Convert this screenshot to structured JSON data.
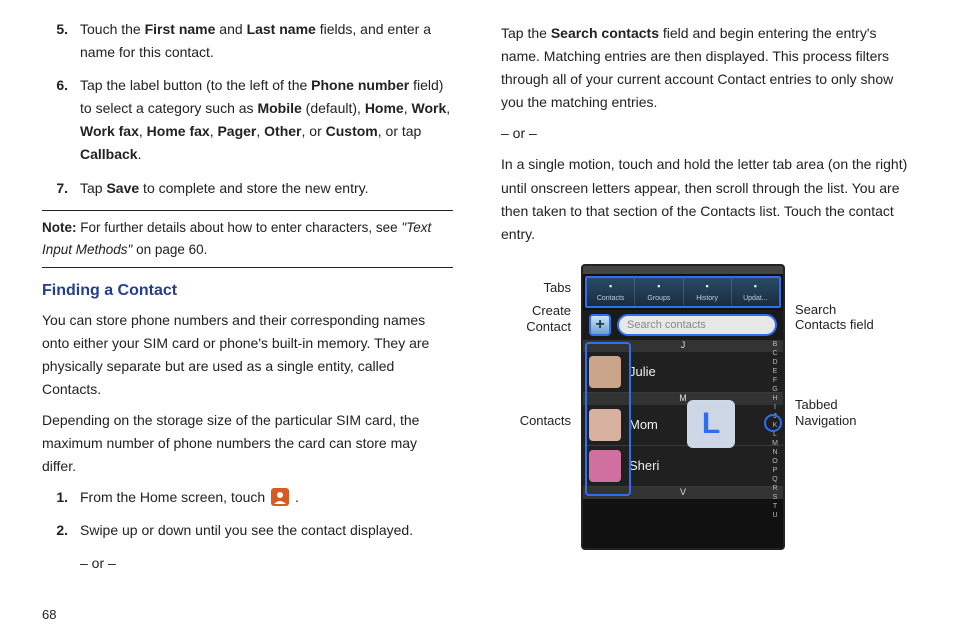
{
  "left": {
    "steps": [
      {
        "n": "5.",
        "parts": [
          "Touch the ",
          {
            "b": "First name"
          },
          " and ",
          {
            "b": "Last name"
          },
          " fields, and enter a name for this contact."
        ]
      },
      {
        "n": "6.",
        "parts": [
          "Tap the label button (to the left of the ",
          {
            "b": "Phone number"
          },
          " field) to select a category such as ",
          {
            "b": "Mobile"
          },
          " (default), ",
          {
            "b": "Home"
          },
          ", ",
          {
            "b": "Work"
          },
          ", ",
          {
            "b": "Work fax"
          },
          ", ",
          {
            "b": "Home fax"
          },
          ", ",
          {
            "b": "Pager"
          },
          ", ",
          {
            "b": "Other"
          },
          ", or ",
          {
            "b": "Custom"
          },
          ", or tap ",
          {
            "b": "Callback"
          },
          "."
        ]
      },
      {
        "n": "7.",
        "parts": [
          "Tap ",
          {
            "b": "Save"
          },
          " to complete and store the new entry."
        ]
      }
    ],
    "note_prefix": "Note:",
    "note_parts": [
      " For further details about how to enter characters, see ",
      {
        "i": "\"Text Input Methods\""
      },
      " on page 60."
    ],
    "heading": "Finding a Contact",
    "para1": "You can store phone numbers and their corresponding names onto either your SIM card or phone's built-in memory. They are physically separate but are used as a single entity, called Contacts.",
    "para2": "Depending on the storage size of the particular SIM card, the maximum number of phone numbers the card can store may differ.",
    "substeps": [
      {
        "n": "1.",
        "parts": [
          "From the Home screen, touch ",
          {
            "icon": true
          },
          " ."
        ]
      },
      {
        "n": "2.",
        "parts": [
          "Swipe up or down until you see the contact displayed."
        ]
      }
    ],
    "or": "– or –"
  },
  "right": {
    "para1_parts": [
      "Tap the ",
      {
        "b": "Search contacts"
      },
      " field and begin entering the entry's name. Matching entries are then displayed. This process filters through all of your current account Contact entries to only show you the matching entries."
    ],
    "or": "– or –",
    "para2": "In a single motion, touch and hold the letter tab area (on the right) until onscreen letters appear, then scroll through the list. You are then taken to that section of the Contacts list. Touch the contact entry."
  },
  "figure": {
    "left_labels": {
      "tabs": "Tabs",
      "create": "Create Contact",
      "contacts": "Contacts"
    },
    "right_labels": {
      "search": "Search Contacts field",
      "tabnav": "Tabbed Navigation"
    },
    "phone": {
      "tabs": [
        "Contacts",
        "Groups",
        "History",
        "Updat..."
      ],
      "search_placeholder": "Search contacts",
      "add_symbol": "+",
      "letter_popup": "L",
      "letter_strip": [
        "B",
        "C",
        "D",
        "E",
        "F",
        "G",
        "H",
        "I",
        "J",
        "K",
        "L",
        "M",
        "N",
        "O",
        "P",
        "Q",
        "R",
        "S",
        "T",
        "U"
      ],
      "dividers": [
        "J",
        "M",
        "V"
      ],
      "entries": [
        {
          "name": "Julie",
          "color": "#caa58a"
        },
        {
          "name": "Mom",
          "color": "#d8b0a0"
        },
        {
          "name": "Sheri",
          "color": "#d070a0"
        }
      ]
    }
  },
  "page_number": "68"
}
